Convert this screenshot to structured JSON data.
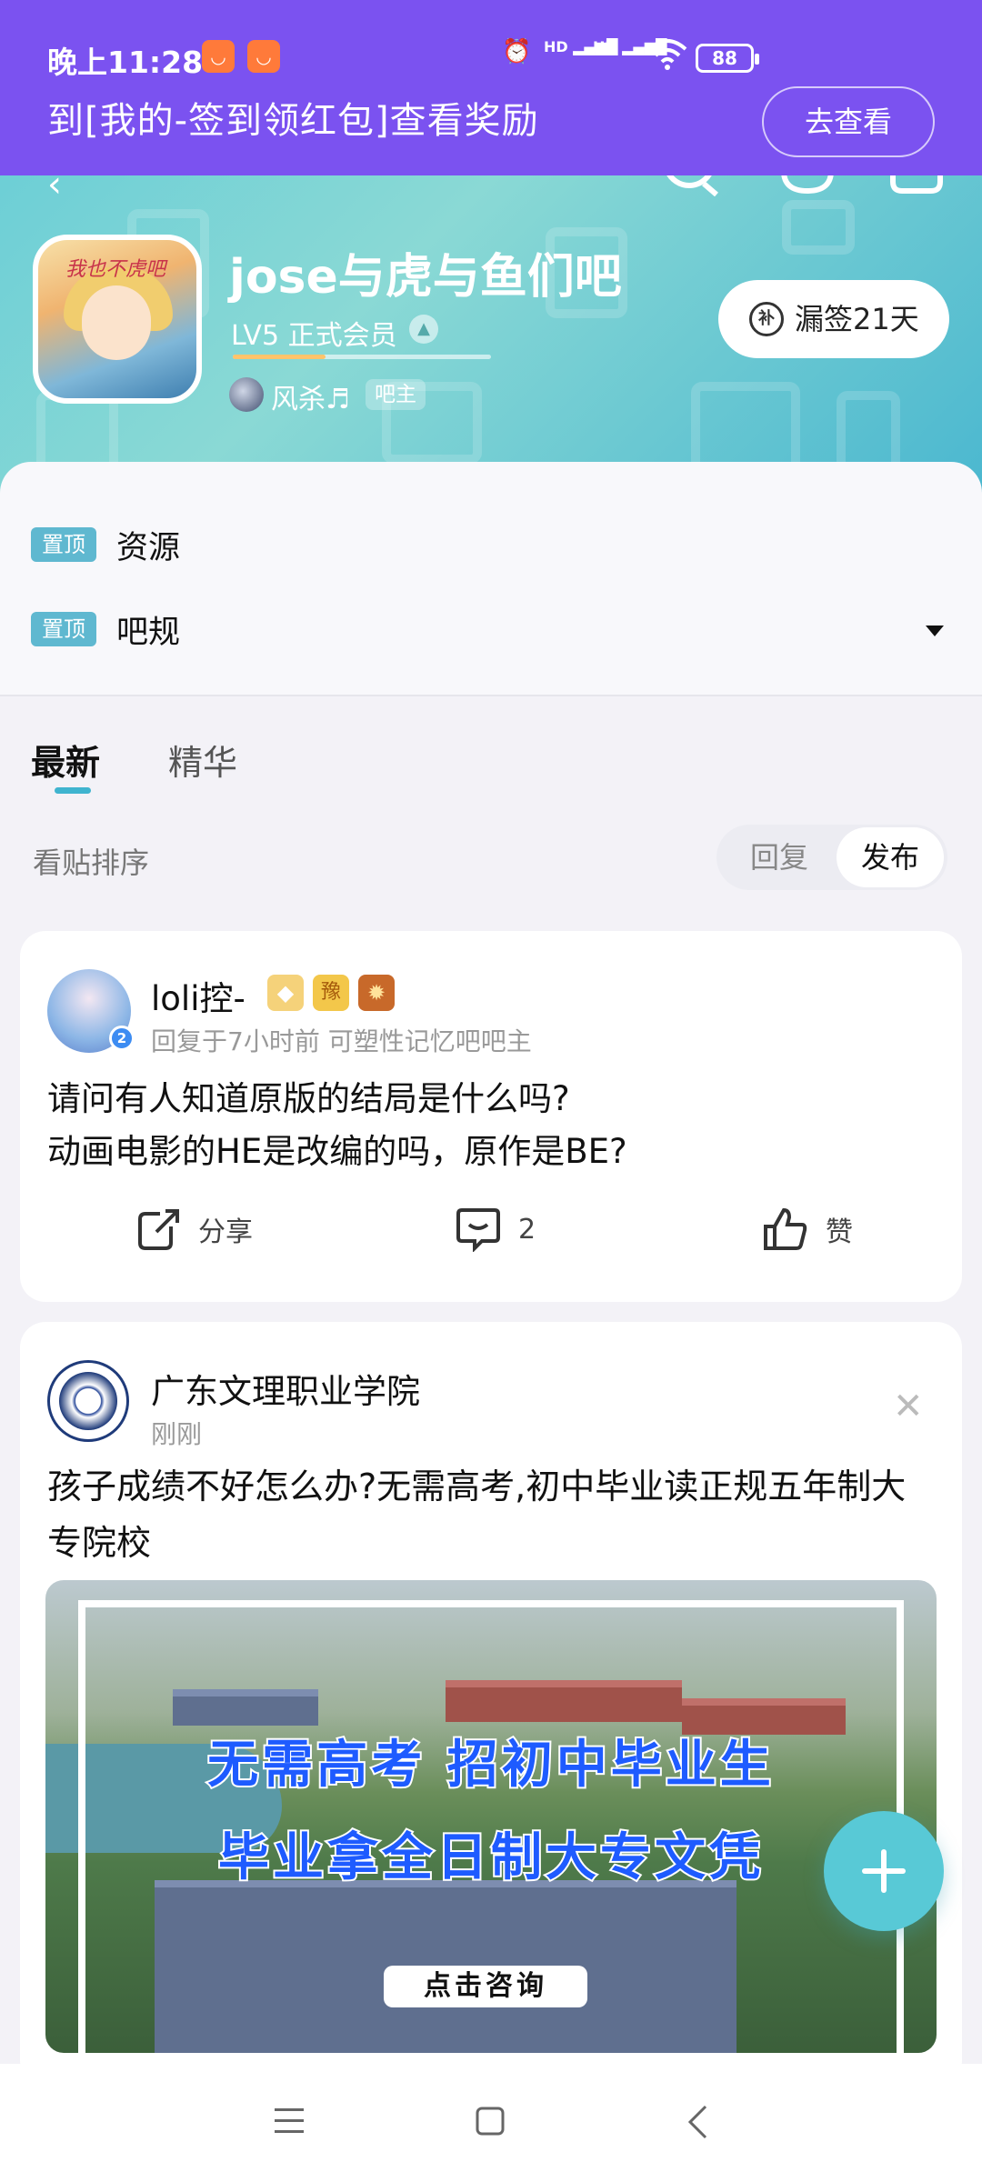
{
  "status_bar": {
    "time": "晚上11:28",
    "hd1": "HD",
    "hd2": "HD",
    "battery": "88"
  },
  "notification": {
    "text": "到[我的-签到领红包]查看奖励",
    "button": "去查看"
  },
  "forum": {
    "name": "jose与虎与鱼们吧",
    "level": "LV5 正式会员",
    "level_progress_percent": 36,
    "owner_name": "风杀♬",
    "owner_role": "吧主",
    "signin_label": "漏签21天",
    "signin_icon_text": "补",
    "avatar_text": "我也不虎吧"
  },
  "pinned": [
    {
      "tag": "置顶",
      "text": "资源"
    },
    {
      "tag": "置顶",
      "text": "吧规"
    }
  ],
  "tabs": {
    "latest": "最新",
    "featured": "精华"
  },
  "sort": {
    "label": "看贴排序",
    "reply": "回复",
    "publish": "发布"
  },
  "post": {
    "username": "loli控-",
    "verified_badge": "2",
    "meta": "回复于7小时前   可塑性记忆吧吧主",
    "line1": "请问有人知道原版的结局是什么吗?",
    "line2": "动画电影的HE是改编的吗，原作是BE?",
    "share": "分享",
    "comments": "2",
    "like": "赞"
  },
  "ad": {
    "name": "广东文理职业学院",
    "time": "刚刚",
    "body": "孩子成绩不好怎么办?无需高考,初中毕业读正规五年制大专院校",
    "image_line1": "无需高考  招初中毕业生",
    "image_line2": "毕业拿全日制大专文凭",
    "image_cta": "点击咨询"
  },
  "colors": {
    "accent": "#3fb4cf",
    "notification_bg": "#7b52f0",
    "fab": "#58c9d6"
  }
}
